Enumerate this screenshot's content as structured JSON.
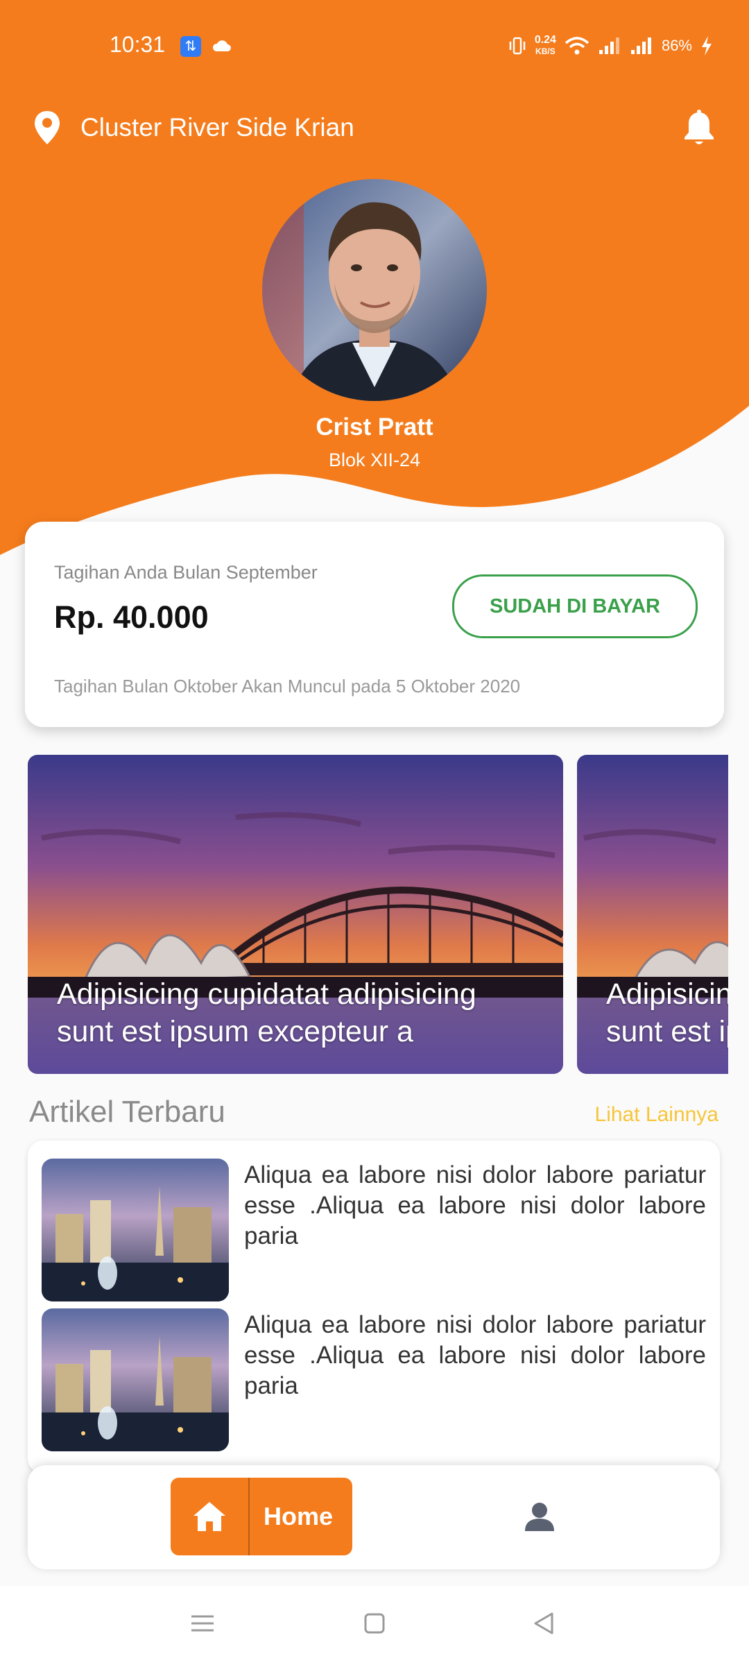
{
  "status_bar": {
    "time": "10:31",
    "speed_value": "0.24",
    "speed_unit": "KB/S",
    "battery": "86%"
  },
  "header": {
    "location": "Cluster River Side Krian",
    "location_icon": "map-pin-icon",
    "notification_icon": "bell-icon"
  },
  "profile": {
    "name": "Crist Pratt",
    "block": "Blok XII-24"
  },
  "bill": {
    "caption": "Tagihan Anda Bulan September",
    "amount": "Rp. 40.000",
    "status": "SUDAH DI BAYAR",
    "note": "Tagihan Bulan Oktober Akan Muncul pada 5 Oktober 2020"
  },
  "carousel": {
    "slides": [
      {
        "line1": "Adipisicing cupidatat adipisicing",
        "line2": "sunt est ipsum excepteur a"
      },
      {
        "line1": "Adipisicing cupidatat adipisicing",
        "line2": "sunt est ipsum excepteur a"
      }
    ]
  },
  "articles": {
    "title": "Artikel Terbaru",
    "see_more": "Lihat Lainnya",
    "items": [
      {
        "text": "Aliqua ea labore nisi dolor labore pariatur esse .Aliqua ea labore nisi dolor labore paria"
      },
      {
        "text": "Aliqua ea labore nisi dolor labore pariatur esse .Aliqua ea labore nisi dolor labore paria"
      }
    ]
  },
  "bottom_nav": {
    "home_label": "Home",
    "home_icon": "home-icon",
    "profile_icon": "person-icon"
  },
  "colors": {
    "primary": "#f47c1c",
    "paid": "#3aa04a",
    "link": "#f7c53a"
  }
}
